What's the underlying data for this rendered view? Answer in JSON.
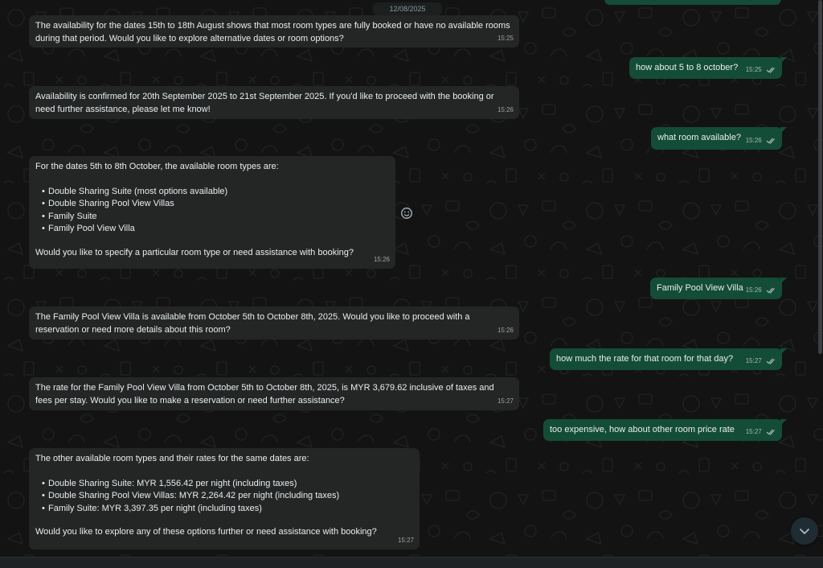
{
  "date_chip": "12/08/2025",
  "colors": {
    "incoming_bubble": "#242626",
    "outgoing_bubble": "#144d37",
    "background": "#131313",
    "read_ticks": "#8fb6d1"
  },
  "messages": [
    {
      "text": "The availability for the dates 15th to 18th August shows that most room types are fully booked or have no available rooms during that period. Would you like to explore alternative dates or room options?",
      "time": "15:25"
    },
    {
      "text": "how about 5 to 8 october?",
      "time": "15:25"
    },
    {
      "text": "Availability is confirmed for 20th September 2025 to 21st September 2025. If you'd like to proceed with the booking or need further assistance, please let me know!",
      "time": "15:26"
    },
    {
      "text": "what room available?",
      "time": "15:26"
    },
    {
      "intro": "For the dates 5th to 8th October, the available room types are:",
      "items": [
        "Double Sharing Suite (most options available)",
        "Double Sharing Pool View Villas",
        "Family Suite",
        "Family Pool View Villa"
      ],
      "outro": "Would you like to specify a particular room type or need assistance with booking?",
      "time": "15:26"
    },
    {
      "text": "Family Pool View Villa",
      "time": "15:26"
    },
    {
      "text": "The Family Pool View Villa is available from October 5th to October 8th, 2025. Would you like to proceed with a reservation or need more details about this room?",
      "time": "15:26"
    },
    {
      "text": "how much the rate for that room for that day?",
      "time": "15:27"
    },
    {
      "text": "The rate for the Family Pool View Villa from October 5th to October 8th, 2025, is MYR 3,679.62 inclusive of taxes and fees per stay. Would you like to make a reservation or need further assistance?",
      "time": "15:27"
    },
    {
      "text": "too expensive, how about other room price rate",
      "time": "15:27"
    },
    {
      "intro": "The other available room types and their rates for the same dates are:",
      "items": [
        "Double Sharing Suite: MYR 1,556.42 per night (including taxes)",
        "Double Sharing Pool View Villas: MYR 2,264.42 per night (including taxes)",
        "Family Suite: MYR 3,397.35 per night (including taxes)"
      ],
      "outro": "Would you like to explore any of these options further or need assistance with booking?",
      "time": "15:27"
    }
  ]
}
